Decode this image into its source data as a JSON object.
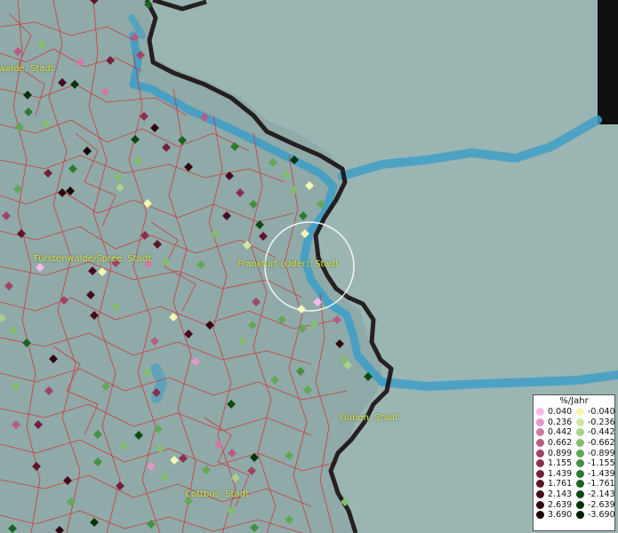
{
  "legend": {
    "title": "%/Jahr",
    "positive": [
      {
        "label": "0.040",
        "color": "#f7b8ec"
      },
      {
        "label": "0.236",
        "color": "#e498c8"
      },
      {
        "label": "0.442",
        "color": "#cf7aa6"
      },
      {
        "label": "0.662",
        "color": "#b85c84"
      },
      {
        "label": "0.899",
        "color": "#a04466"
      },
      {
        "label": "1.155",
        "color": "#8a2f4e"
      },
      {
        "label": "1.439",
        "color": "#74203c"
      },
      {
        "label": "1.761",
        "color": "#5e152c"
      },
      {
        "label": "2.143",
        "color": "#480b1e"
      },
      {
        "label": "2.639",
        "color": "#320512"
      },
      {
        "label": "3.690",
        "color": "#1c0008"
      }
    ],
    "negative": [
      {
        "label": "-0.040",
        "color": "#f3f7b4"
      },
      {
        "label": "-0.236",
        "color": "#cfe7a2"
      },
      {
        "label": "-0.442",
        "color": "#a9d28a"
      },
      {
        "label": "-0.662",
        "color": "#84bd70"
      },
      {
        "label": "-0.899",
        "color": "#62a758"
      },
      {
        "label": "-1.155",
        "color": "#459142"
      },
      {
        "label": "-1.439",
        "color": "#2d7a30"
      },
      {
        "label": "-1.761",
        "color": "#1b6322"
      },
      {
        "label": "-2.143",
        "color": "#0e4a15"
      },
      {
        "label": "-2.639",
        "color": "#06330b"
      },
      {
        "label": "-3.690",
        "color": "#011c04"
      }
    ]
  },
  "cities": [
    {
      "id": "eberswalde",
      "label": "walde, Stadt"
    },
    {
      "id": "fuerstenwalde",
      "label": "Fürstenwalde/Spree, Stadt"
    },
    {
      "id": "frankfurt",
      "label": "Frankfurt (Oder), Stadt"
    },
    {
      "id": "guben",
      "label": "Guben, Stadt"
    },
    {
      "id": "cottbus",
      "label": "Cottbus, Stadt"
    }
  ],
  "colors": {
    "land": "#8faaa8",
    "poland": "#9bb5b3",
    "water": "#3f9fc7",
    "border": "#1a1010",
    "municipal_lines": "#d8262a",
    "label": "#e2e64a",
    "highlight_circle": "#ffffff"
  }
}
